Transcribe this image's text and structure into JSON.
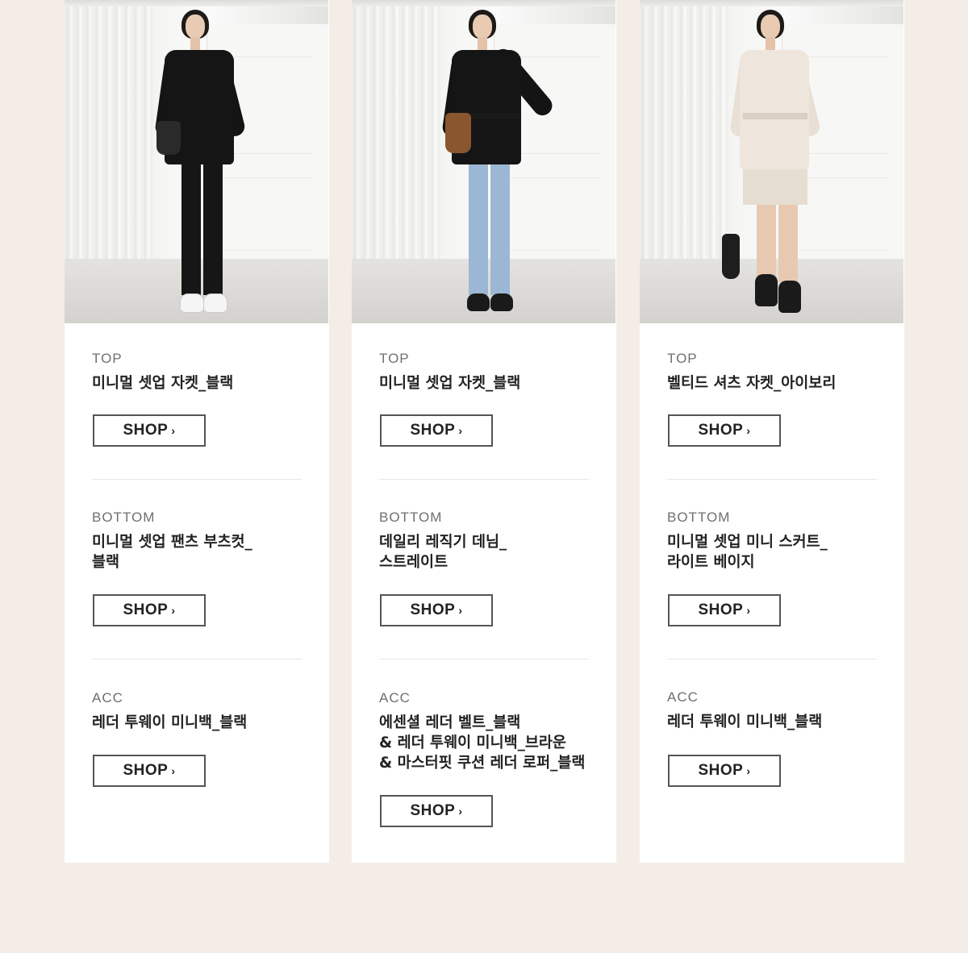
{
  "cards": [
    {
      "top": {
        "category": "TOP",
        "name": "미니멀 셋업 자켓_블랙",
        "shop": "SHOP"
      },
      "bottom": {
        "category": "BOTTOM",
        "name": "미니멀 셋업 팬츠 부츠컷_\n블랙",
        "shop": "SHOP"
      },
      "acc": {
        "category": "ACC",
        "name": "레더 투웨이 미니백_블랙",
        "shop": "SHOP"
      }
    },
    {
      "top": {
        "category": "TOP",
        "name": "미니멀 셋업 자켓_블랙",
        "shop": "SHOP"
      },
      "bottom": {
        "category": "BOTTOM",
        "name": "데일리 레직기 데님_\n스트레이트",
        "shop": "SHOP"
      },
      "acc": {
        "category": "ACC",
        "name": "에센셜 레더 벨트_블랙\n& 레더 투웨이 미니백_브라운\n& 마스터핏 쿠션 레더 로퍼_블랙",
        "shop": "SHOP"
      }
    },
    {
      "top": {
        "category": "TOP",
        "name": "벨티드 셔츠 자켓_아이보리",
        "shop": "SHOP"
      },
      "bottom": {
        "category": "BOTTOM",
        "name": "미니멀 셋업 미니 스커트_\n라이트 베이지",
        "shop": "SHOP"
      },
      "acc": {
        "category": "ACC",
        "name": "레더 투웨이 미니백_블랙",
        "shop": "SHOP"
      }
    }
  ],
  "icons": {
    "shop_arrow": "chevron-right-icon"
  },
  "colors": {
    "background": "#f4ede7",
    "card": "#ffffff",
    "button_border": "#555555",
    "category_text": "#6f6f6f"
  }
}
